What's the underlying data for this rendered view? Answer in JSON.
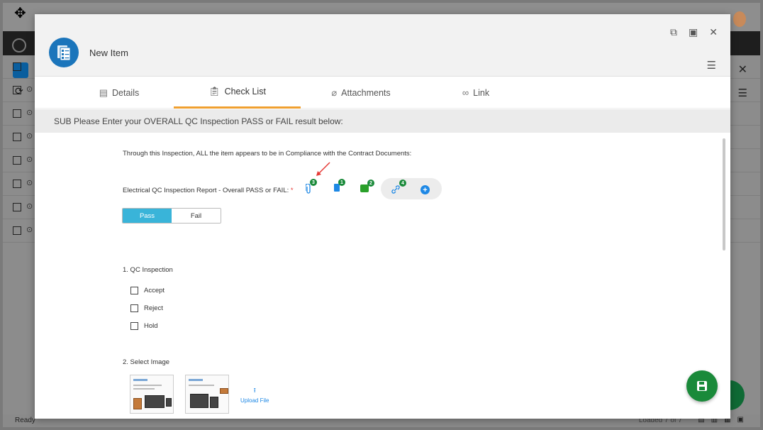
{
  "background": {
    "status_ready": "Ready",
    "status_loaded": "Loaded 7 of 7",
    "row_count": 7
  },
  "modal": {
    "title": "New Item",
    "tabs": [
      {
        "label": "Details",
        "icon": "details-icon"
      },
      {
        "label": "Check List",
        "icon": "clipboard-icon",
        "active": true
      },
      {
        "label": "Attachments",
        "icon": "paperclip-icon"
      },
      {
        "label": "Link",
        "icon": "link-icon"
      }
    ],
    "section_header": "SUB Please Enter your OVERALL QC Inspection PASS or FAIL result below:",
    "compliance_text": "Through this Inspection, ALL the item appears to be in Compliance with the Contract Documents:",
    "report_label": "Electrical QC Inspection Report - Overall PASS or FAIL:",
    "required_mark": "*",
    "badges": {
      "attachments": "3",
      "documents": "1",
      "comments": "2",
      "links": "4"
    },
    "pass_fail": {
      "pass": "Pass",
      "fail": "Fail",
      "selected": "Pass"
    },
    "q1": {
      "title": "1. QC Inspection",
      "options": [
        "Accept",
        "Reject",
        "Hold"
      ]
    },
    "q2": {
      "title": "2. Select Image",
      "upload_label": "Upload File"
    }
  },
  "colors": {
    "accent_tab": "#f0a030",
    "pass_selected": "#39b4d9",
    "primary_blue": "#1e88e5",
    "fab_green": "#1a8a3a"
  }
}
